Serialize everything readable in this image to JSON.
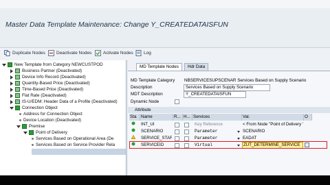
{
  "window": {
    "title": "Master Data Template Maintenance: Change Y_CREATEDATAISFUN"
  },
  "toolbar": {
    "duplicate_label": "Duplicate Nodes",
    "deactivate_label": "Deactivate Nodes",
    "activate_label": "Activate Nodes",
    "log_label": "Log"
  },
  "tree": {
    "root": "New Template from Category NEWCUSTPOD",
    "items": [
      "Business Partner (Deactivated)",
      "Device Info Record (Deactivated)",
      "Quantity-Based Price (Deactivated)",
      "Time-Based Price (Deactivated)",
      "Flat Rate (Deactivated)",
      "IS-U/EDM: Header Data of a Profile (Deactivated)",
      "Connection Object",
      "Address for Connection Object",
      "Device Location (Deactivated)",
      "Premise",
      "Point of Delivery",
      "Services Based on Operational Area (De",
      "Services Based on Service Provider Rela"
    ]
  },
  "tabs": {
    "tab1": "MD Template Nodes",
    "tab2": "Hdr Data"
  },
  "form": {
    "category_label": "MD Template Category",
    "category_value": "NBSERVICESUPSCENAR Services Based on Supply Scenario",
    "description_label": "Description",
    "description_value": "Services Based on Supply Scenario",
    "mdt_label": "MDT Description",
    "mdt_value": "Y_CREATEDATAISFUN",
    "dynamic_label": "Dynamic Node"
  },
  "attributes": {
    "section_title": "Attribute",
    "headers": {
      "sta": "Sta",
      "name": "Name",
      "r": "R...",
      "h": "H...",
      "services": "Services",
      "val": "Val.",
      "o": "O"
    },
    "rows": [
      {
        "name": "INT_UI",
        "services": "Key Reference",
        "val": "< From Node \"Point of Delivery \"..."
      },
      {
        "name": "SCENARIO",
        "services": "Parameter",
        "val": "SCENARIO"
      },
      {
        "name": "SERVICE_STAR",
        "services": "Parameter",
        "val": "EADAT"
      },
      {
        "name": "SERVICEID",
        "services": "Virtual",
        "val": "ZUT_DETERMINE_SERVICE"
      }
    ]
  },
  "colors": {
    "highlight": "#e01a1a",
    "status_green": "#2e9a3b",
    "value_field": "#ffef9e"
  }
}
